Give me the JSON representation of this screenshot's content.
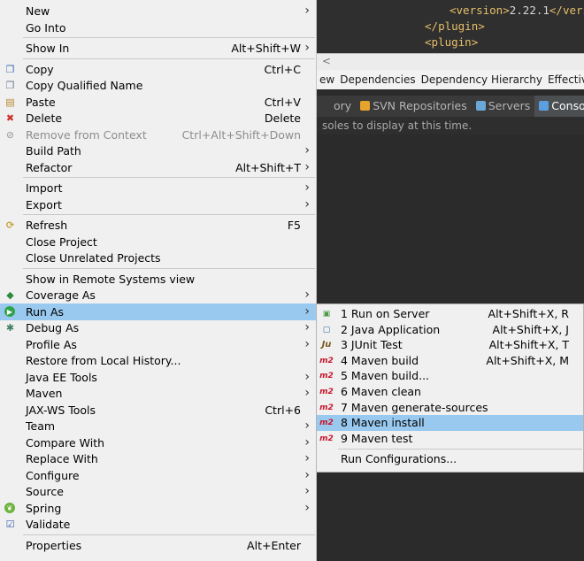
{
  "editor": {
    "lines": [
      {
        "open": "<",
        "name": "version",
        "close": ">",
        "text": "2.22.1",
        "end": "</vers"
      },
      {
        "open": "</",
        "name": "plugin",
        "close": ">",
        "text": "",
        "end": ""
      },
      {
        "open": "<",
        "name": "plugin",
        "close": ">",
        "text": "",
        "end": ""
      }
    ]
  },
  "pom_tabs": [
    "ew",
    "Dependencies",
    "Dependency Hierarchy",
    "Effective PC"
  ],
  "view_tabs": [
    {
      "label": "ory",
      "icon": "history-icon",
      "color": "#3a3a3a",
      "active": false
    },
    {
      "label": "SVN Repositories",
      "icon": "svn-icon",
      "color": "#e5a32b",
      "active": false
    },
    {
      "label": "Servers",
      "icon": "servers-icon",
      "color": "#6aa8d8",
      "active": false
    },
    {
      "label": "Console",
      "icon": "console-icon",
      "color": "#5aa0e0",
      "active": true
    }
  ],
  "console_close": "×",
  "console_message": "soles to display at this time.",
  "menu": {
    "items": [
      {
        "label": "New",
        "submenu": true
      },
      {
        "label": "Go Into"
      },
      {
        "sep": true
      },
      {
        "label": "Show In",
        "shortcut": "Alt+Shift+W",
        "submenu": true
      },
      {
        "sep": true
      },
      {
        "label": "Copy",
        "shortcut": "Ctrl+C",
        "icon": "copy-icon"
      },
      {
        "label": "Copy Qualified Name",
        "icon": "copy-qualified-name-icon"
      },
      {
        "label": "Paste",
        "shortcut": "Ctrl+V",
        "icon": "paste-icon"
      },
      {
        "label": "Delete",
        "shortcut": "Delete",
        "icon": "delete-icon"
      },
      {
        "label": "Remove from Context",
        "shortcut": "Ctrl+Alt+Shift+Down",
        "icon": "remove-context-icon",
        "disabled": true
      },
      {
        "label": "Build Path",
        "submenu": true
      },
      {
        "label": "Refactor",
        "shortcut": "Alt+Shift+T",
        "submenu": true
      },
      {
        "sep": true
      },
      {
        "label": "Import",
        "submenu": true
      },
      {
        "label": "Export",
        "submenu": true
      },
      {
        "sep": true
      },
      {
        "label": "Refresh",
        "shortcut": "F5",
        "icon": "refresh-icon"
      },
      {
        "label": "Close Project"
      },
      {
        "label": "Close Unrelated Projects"
      },
      {
        "sep": true
      },
      {
        "label": "Show in Remote Systems view"
      },
      {
        "label": "Coverage As",
        "submenu": true,
        "icon": "coverage-icon"
      },
      {
        "label": "Run As",
        "submenu": true,
        "icon": "run-icon",
        "highlighted": true
      },
      {
        "label": "Debug As",
        "submenu": true,
        "icon": "debug-icon"
      },
      {
        "label": "Profile As",
        "submenu": true
      },
      {
        "label": "Restore from Local History..."
      },
      {
        "label": "Java EE Tools",
        "submenu": true
      },
      {
        "label": "Maven",
        "submenu": true
      },
      {
        "label": "JAX-WS Tools",
        "shortcut": "Ctrl+6"
      },
      {
        "label": "Team",
        "submenu": true
      },
      {
        "label": "Compare With",
        "submenu": true
      },
      {
        "label": "Replace With",
        "submenu": true
      },
      {
        "label": "Configure",
        "submenu": true
      },
      {
        "label": "Source",
        "submenu": true
      },
      {
        "label": "Spring",
        "submenu": true,
        "icon": "spring-icon"
      },
      {
        "label": "Validate",
        "icon": "validate-icon"
      },
      {
        "sep": true
      },
      {
        "label": "Properties",
        "shortcut": "Alt+Enter"
      }
    ]
  },
  "run_as_submenu": {
    "items": [
      {
        "label": "1 Run on Server",
        "shortcut": "Alt+Shift+X, R",
        "icon": "run-on-server-icon"
      },
      {
        "label": "2 Java Application",
        "shortcut": "Alt+Shift+X, J",
        "icon": "java-application-icon"
      },
      {
        "label": "3 JUnit Test",
        "shortcut": "Alt+Shift+X, T",
        "icon": "junit-icon"
      },
      {
        "label": "4 Maven build",
        "shortcut": "Alt+Shift+X, M",
        "icon": "m2-icon"
      },
      {
        "label": "5 Maven build...",
        "icon": "m2-icon"
      },
      {
        "label": "6 Maven clean",
        "icon": "m2-icon"
      },
      {
        "label": "7 Maven generate-sources",
        "icon": "m2-icon"
      },
      {
        "label": "8 Maven install",
        "icon": "m2-icon",
        "highlighted": true
      },
      {
        "label": "9 Maven test",
        "icon": "m2-icon"
      },
      {
        "sep": true
      },
      {
        "label": "Run Configurations..."
      }
    ]
  },
  "colors": {
    "highlight": "#99c9ef",
    "menu_bg": "#f0f0f0",
    "editor_bg": "#2f2f2f",
    "xml_tag": "#e8bf6a",
    "m2_red": "#c7162b"
  }
}
